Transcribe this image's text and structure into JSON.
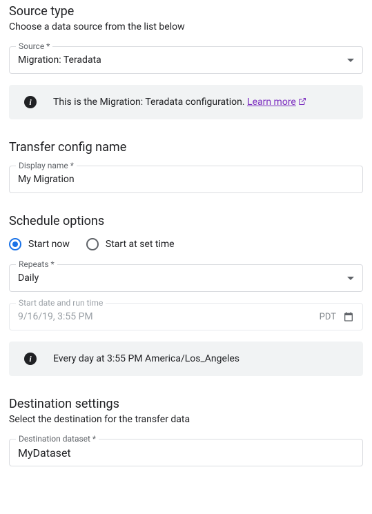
{
  "source": {
    "title": "Source type",
    "desc": "Choose a data source from the list below",
    "field_label": "Source *",
    "value": "Migration: Teradata",
    "info_text": "This is the Migration: Teradata configuration. ",
    "info_link": "Learn more"
  },
  "transfer": {
    "title": "Transfer config name",
    "field_label": "Display name *",
    "value": "My Migration"
  },
  "schedule": {
    "title": "Schedule options",
    "radio_now": "Start now",
    "radio_set": "Start at set time",
    "repeats_label": "Repeats *",
    "repeats_value": "Daily",
    "dt_label": "Start date and run time",
    "dt_value": "9/16/19, 3:55 PM",
    "dt_tz": "PDT",
    "info_text": "Every day at 3:55 PM America/Los_Angeles"
  },
  "destination": {
    "title": "Destination settings",
    "desc": "Select the destination for the transfer data",
    "field_label": "Destination dataset *",
    "value": "MyDataset"
  }
}
